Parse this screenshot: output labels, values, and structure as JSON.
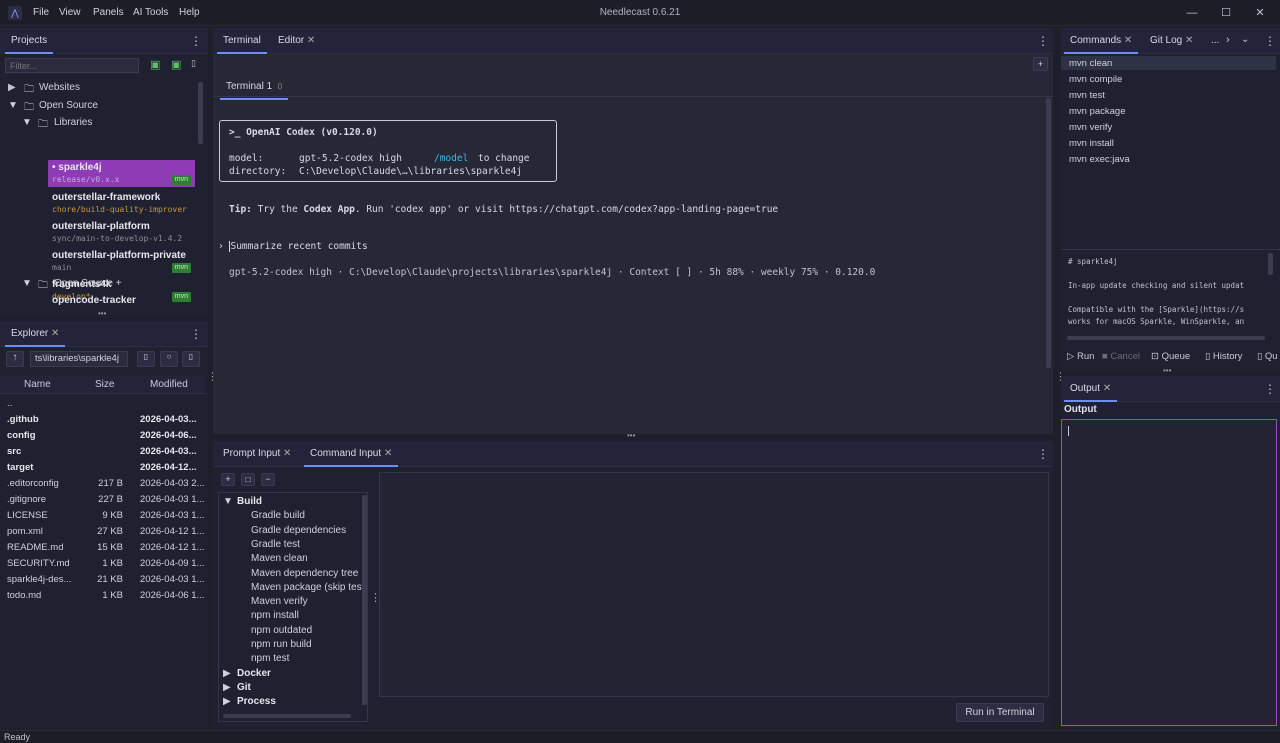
{
  "titlebar": {
    "menus": [
      "File",
      "View",
      "Panels",
      "AI Tools",
      "Help"
    ],
    "title": "Needlecast 0.6.21"
  },
  "projects": {
    "tab": "Projects",
    "filter_placeholder": "Filter...",
    "tree": [
      {
        "label": "Websites"
      },
      {
        "label": "Open Source"
      },
      {
        "label": "Libraries"
      },
      {
        "label": "sparkle4j",
        "sub": "release/v0.x.x",
        "badge": "mvn"
      },
      {
        "label": "outerstellar-framework",
        "sub": "chore/build-quality-improver"
      },
      {
        "label": "outerstellar-platform",
        "sub": "sync/main-to-develop-v1.4.2"
      },
      {
        "label": "outerstellar-platform-private",
        "sub": "main",
        "badge": "mvn"
      },
      {
        "label": "fragments4k",
        "sub": "develop*",
        "badge": "mvn"
      },
      {
        "label": "Open Source +"
      },
      {
        "label": "opencode-tracker"
      }
    ]
  },
  "explorer": {
    "tab": "Explorer",
    "path": "ts\\libraries\\sparkle4j",
    "cols": {
      "name": "Name",
      "size": "Size",
      "modified": "Modified"
    },
    "files": [
      {
        "name": "..",
        "size": "",
        "mod": ""
      },
      {
        "name": ".github",
        "size": "",
        "mod": "2026-04-03...",
        "bold": true
      },
      {
        "name": "config",
        "size": "",
        "mod": "2026-04-06...",
        "bold": true
      },
      {
        "name": "src",
        "size": "",
        "mod": "2026-04-03...",
        "bold": true
      },
      {
        "name": "target",
        "size": "",
        "mod": "2026-04-12...",
        "bold": true
      },
      {
        "name": ".editorconfig",
        "size": "217 B",
        "mod": "2026-04-03 2..."
      },
      {
        "name": ".gitignore",
        "size": "227 B",
        "mod": "2026-04-03 1..."
      },
      {
        "name": "LICENSE",
        "size": "9 KB",
        "mod": "2026-04-03 1..."
      },
      {
        "name": "pom.xml",
        "size": "27 KB",
        "mod": "2026-04-12 1..."
      },
      {
        "name": "README.md",
        "size": "15 KB",
        "mod": "2026-04-12 1..."
      },
      {
        "name": "SECURITY.md",
        "size": "1 KB",
        "mod": "2026-04-09 1..."
      },
      {
        "name": "sparkle4j-des...",
        "size": "21 KB",
        "mod": "2026-04-03 1..."
      },
      {
        "name": "todo.md",
        "size": "1 KB",
        "mod": "2026-04-06 1..."
      }
    ]
  },
  "center": {
    "tabs": [
      "Terminal",
      "Editor"
    ],
    "subtab": "Terminal 1",
    "subtab_badge": "0",
    "add": "+",
    "term": {
      "box_title": ">_ OpenAI Codex (v0.120.0)",
      "model_key": "model:",
      "model_val": "gpt-5.2-codex high",
      "model_link": "/model",
      "model_suffix": "to change",
      "dir_key": "directory:",
      "dir_val": "C:\\Develop\\Claude\\…\\libraries\\sparkle4j",
      "tip_label": "Tip:",
      "tip_pre": "Try the",
      "tip_bold": "Codex App",
      "tip_post": ". Run 'codex app' or visit https://chatgpt.com/codex?app-landing-page=true",
      "prompt": "Summarize recent commits",
      "prompt_arrow": "›",
      "status": "gpt-5.2-codex high · C:\\Develop\\Claude\\projects\\libraries\\sparkle4j · Context [     ] · 5h 88% · weekly 75% · 0.120.0"
    }
  },
  "input": {
    "tabs": [
      "Prompt Input",
      "Command Input"
    ],
    "tool": [
      "+",
      "□",
      "−"
    ],
    "tree": [
      {
        "label": "Build",
        "group": true
      },
      {
        "label": "Gradle build"
      },
      {
        "label": "Gradle dependencies"
      },
      {
        "label": "Gradle test"
      },
      {
        "label": "Maven clean"
      },
      {
        "label": "Maven dependency tree"
      },
      {
        "label": "Maven package (skip tests"
      },
      {
        "label": "Maven verify"
      },
      {
        "label": "npm install"
      },
      {
        "label": "npm outdated"
      },
      {
        "label": "npm run build"
      },
      {
        "label": "npm test"
      },
      {
        "label": "Docker",
        "group": true
      },
      {
        "label": "Git",
        "group": true
      },
      {
        "label": "Process",
        "group": true
      }
    ],
    "run": "Run in Terminal"
  },
  "commands": {
    "tabs": [
      "Commands",
      "Git Log",
      "..."
    ],
    "items": [
      "mvn clean",
      "mvn compile",
      "mvn test",
      "mvn package",
      "mvn verify",
      "mvn install",
      "mvn exec:java"
    ],
    "readme": [
      "# sparkle4j",
      "In-app update checking and silent updat",
      "Compatible with the [Sparkle](https://s",
      "works for macOS Sparkle, WinSparkle, an"
    ],
    "actions": [
      "Run",
      "Cancel",
      "Queue",
      "History",
      "Qu"
    ]
  },
  "output": {
    "tab": "Output",
    "heading": "Output"
  },
  "status": "Ready"
}
